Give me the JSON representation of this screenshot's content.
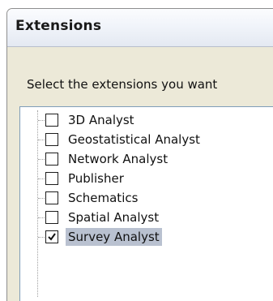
{
  "window": {
    "title": "Extensions",
    "prompt": "Select the extensions you want"
  },
  "extensions": [
    {
      "label": "3D Analyst",
      "checked": false,
      "selected": false
    },
    {
      "label": "Geostatistical Analyst",
      "checked": false,
      "selected": false
    },
    {
      "label": "Network Analyst",
      "checked": false,
      "selected": false
    },
    {
      "label": "Publisher",
      "checked": false,
      "selected": false
    },
    {
      "label": "Schematics",
      "checked": false,
      "selected": false
    },
    {
      "label": "Spatial Analyst",
      "checked": false,
      "selected": false
    },
    {
      "label": "Survey Analyst",
      "checked": true,
      "selected": true
    }
  ],
  "colors": {
    "dialog_bg": "#ece9d8",
    "selection_bg": "#b9c1d0",
    "list_border": "#7f9db9"
  }
}
